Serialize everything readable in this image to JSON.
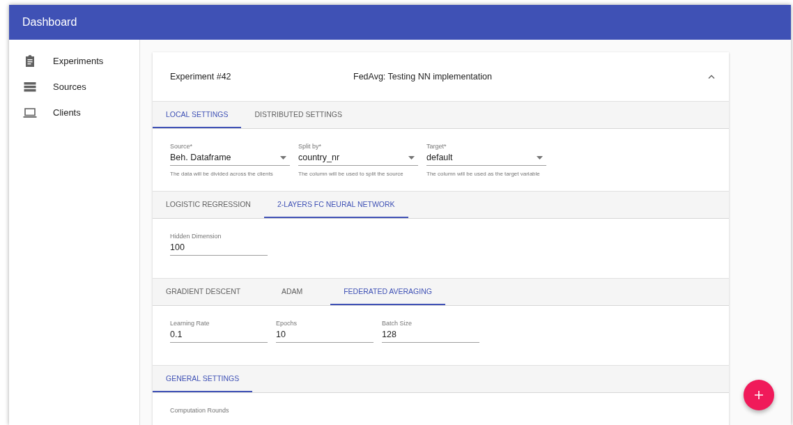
{
  "app_bar": {
    "title": "Dashboard"
  },
  "sidebar": {
    "items": [
      {
        "label": "Experiments",
        "kind": "clipboard",
        "selected": false
      },
      {
        "label": "Sources",
        "kind": "list",
        "selected": false
      },
      {
        "label": "Clients",
        "kind": "laptop",
        "selected": false
      }
    ]
  },
  "experiment": {
    "name": "Experiment #42",
    "title": "FedAvg: Testing NN implementation",
    "expanded": true
  },
  "sections": [
    {
      "tabs": [
        {
          "label": "LOCAL SETTINGS",
          "selected": true
        },
        {
          "label": "DISTRIBUTED SETTINGS",
          "selected": false
        }
      ],
      "fields": [
        {
          "kind": "select",
          "label": "Source*",
          "value": "Beh. Dataframe",
          "helper": "The data will be divided across the clients"
        },
        {
          "kind": "select",
          "label": "Split by*",
          "value": "country_nr",
          "helper": "The column will be used to split the source"
        },
        {
          "kind": "select",
          "label": "Target*",
          "value": "default",
          "helper": "The column will be used as the target variable"
        }
      ]
    },
    {
      "tabs": [
        {
          "label": "LOGISTIC REGRESSION",
          "selected": false
        },
        {
          "label": "2-LAYERS FC NEURAL NETWORK",
          "selected": true
        }
      ],
      "fields": [
        {
          "kind": "text",
          "label": "Hidden Dimension",
          "value": "100"
        }
      ]
    },
    {
      "tabs": [
        {
          "label": "GRADIENT DESCENT",
          "selected": false
        },
        {
          "label": "ADAM",
          "selected": false
        },
        {
          "label": "FEDERATED AVERAGING",
          "selected": true
        }
      ],
      "fields": [
        {
          "kind": "text",
          "label": "Learning Rate",
          "value": "0.1"
        },
        {
          "kind": "text",
          "label": "Epochs",
          "value": "10"
        },
        {
          "kind": "text",
          "label": "Batch Size",
          "value": "128"
        }
      ]
    },
    {
      "tabs": [
        {
          "label": "GENERAL SETTINGS",
          "selected": true
        }
      ],
      "fields": [
        {
          "kind": "text",
          "label": "Computation Rounds"
        }
      ]
    }
  ]
}
